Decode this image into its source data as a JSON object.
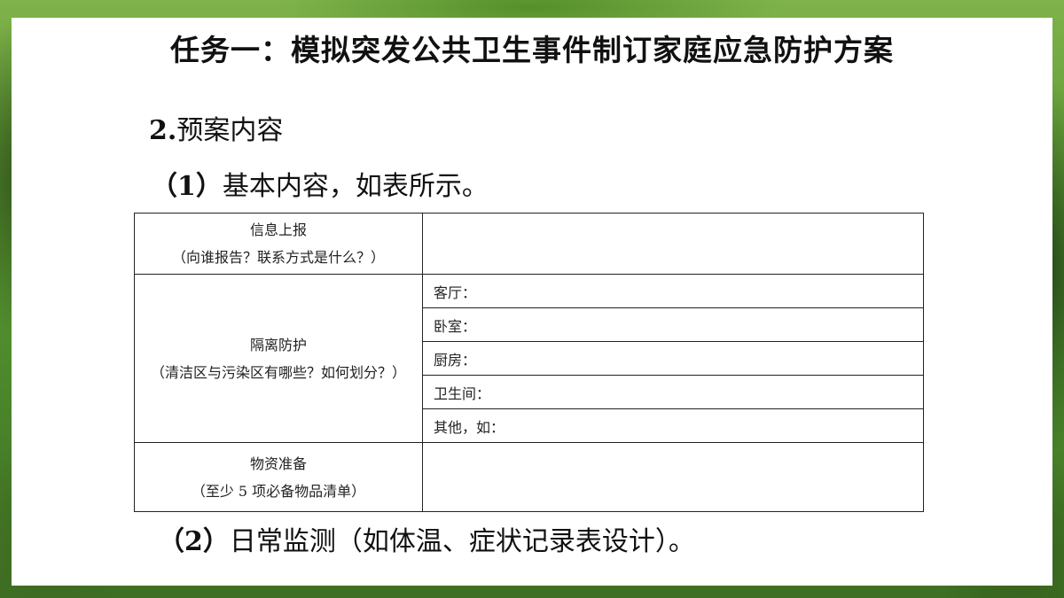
{
  "title": "任务一：模拟突发公共卫生事件制订家庭应急防护方案",
  "heading": {
    "number": "2.",
    "text": "预案内容"
  },
  "subheading_1": {
    "number": "（1）",
    "text": "基本内容，如表所示。"
  },
  "subheading_2": {
    "number": "（2）",
    "text": "日常监测（如体温、症状记录表设计）。"
  },
  "table": {
    "info": {
      "label": "信息上报",
      "hint": "（向谁报告？联系方式是什么？）",
      "value": ""
    },
    "isolation": {
      "label": "隔离防护",
      "hint": "（清洁区与污染区有哪些？如何划分？）",
      "rows": [
        "客厅：",
        "卧室：",
        "厨房：",
        "卫生间：",
        "其他，如："
      ]
    },
    "supplies": {
      "label": "物资准备",
      "hint": "（至少 5 项必备物品清单）",
      "value": ""
    }
  },
  "colors": {
    "panel": "#ffffff",
    "text": "#111111",
    "border": "#222222",
    "background": "#5e9a35"
  }
}
